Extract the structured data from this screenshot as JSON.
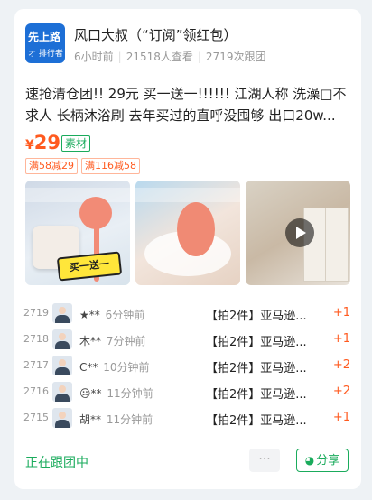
{
  "post": {
    "logo_line1": "先上路",
    "logo_line2": "オ 排行者",
    "author_title": "风口大叔（“订阅”领红包）",
    "time_ago": "6小时前",
    "views": "21518人查看",
    "follows": "2719次跟团",
    "headline": "速抢清仓团!! 29元 买一送一!!!!!! 江湖人称 洗澡□不求人 长柄沐浴刷 去年买过的直呼没囤够 出口20w...",
    "price_symbol": "¥",
    "price": "29",
    "tag": "素材",
    "coupons": [
      "满58减29",
      "满116减58"
    ],
    "sticker_text": "买一送一",
    "thumb_icons": [
      "product-photo",
      "product-photo",
      "play-icon"
    ]
  },
  "orders": [
    {
      "rank": "2719",
      "user": "★**",
      "time": "6分钟前",
      "item": "【拍2件】亚马逊...",
      "delta": "+1"
    },
    {
      "rank": "2718",
      "user": "木**",
      "time": "7分钟前",
      "item": "【拍2件】亚马逊...",
      "delta": "+1"
    },
    {
      "rank": "2717",
      "user": "C**",
      "time": "10分钟前",
      "item": "【拍2件】亚马逊...",
      "delta": "+2"
    },
    {
      "rank": "2716",
      "user": "☹**",
      "time": "11分钟前",
      "item": "【拍2件】亚马逊...",
      "delta": "+2"
    },
    {
      "rank": "2715",
      "user": "胡**",
      "time": "11分钟前",
      "item": "【拍2件】亚马逊...",
      "delta": "+1"
    }
  ],
  "footer": {
    "following_label": "正在跟团中",
    "more_label": "···",
    "share_label": "分享"
  },
  "colors": {
    "accent_green": "#1aab5c",
    "price_orange": "#ff5a1f"
  }
}
